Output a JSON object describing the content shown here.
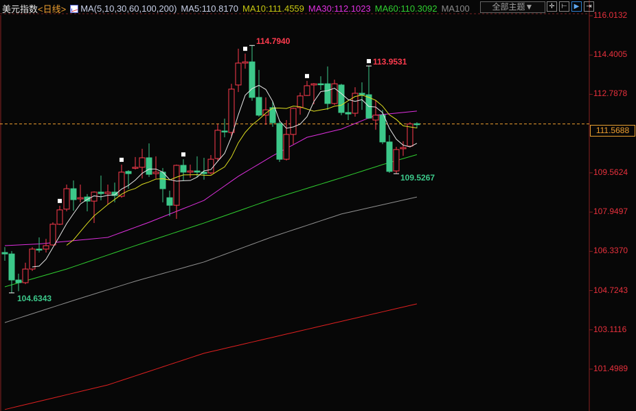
{
  "header": {
    "title": "美元指数",
    "period": "<日线>",
    "ma_label": "MA(5,10,30,60,100,200)",
    "ma5": "MA5:110.8170",
    "ma10": "MA10:111.4559",
    "ma30": "MA30:112.1023",
    "ma60": "MA60:110.3092",
    "ma100": "MA100",
    "theme_button": "全部主题▼",
    "tools": [
      "crosshair-tool",
      "range-tool",
      "move-right-tool",
      "move-end-tool"
    ]
  },
  "colors": {
    "up": "#ff3b4e",
    "down": "#3cc88a",
    "ma5": "#e8e8e8",
    "ma10": "#e0e020",
    "ma30": "#e030e0",
    "ma60": "#30d030",
    "ma100": "#909090",
    "ma200": "#e02020",
    "axis": "#e8303c",
    "last": "#f0a030"
  },
  "chart_data": {
    "type": "candlestick",
    "title": "美元指数 日线",
    "ylim": [
      99.78,
      116.66
    ],
    "yticks": [
      "116.0132",
      "114.4005",
      "112.7878",
      "109.5624",
      "107.9497",
      "106.3370",
      "104.7243",
      "103.1116",
      "101.4989"
    ],
    "last_price": "111.5688",
    "candles": [
      [
        106.29,
        106.23,
        106.51,
        105.95
      ],
      [
        106.23,
        105.16,
        106.35,
        104.63
      ],
      [
        105.16,
        105.05,
        105.42,
        104.7
      ],
      [
        105.05,
        105.61,
        105.87,
        104.99
      ],
      [
        105.61,
        106.43,
        106.51,
        105.53
      ],
      [
        106.43,
        106.4,
        106.91,
        106.29
      ],
      [
        106.43,
        106.57,
        106.85,
        106.29
      ],
      [
        106.6,
        107.45,
        107.53,
        106.57
      ],
      [
        107.45,
        108.04,
        108.21,
        107.42
      ],
      [
        108.07,
        108.91,
        109.08,
        107.98
      ],
      [
        108.91,
        108.46,
        109.25,
        108.01
      ],
      [
        108.49,
        108.54,
        109.08,
        108.35
      ],
      [
        108.57,
        108.4,
        108.69,
        107.98
      ],
      [
        108.4,
        108.77,
        108.8,
        107.5
      ],
      [
        108.77,
        108.71,
        109.45,
        108.43
      ],
      [
        108.71,
        108.77,
        109.08,
        108.26
      ],
      [
        108.77,
        108.63,
        109.16,
        108.35
      ],
      [
        108.6,
        109.59,
        109.9,
        108.54
      ],
      [
        109.62,
        109.53,
        109.67,
        108.91
      ],
      [
        109.76,
        109.79,
        110.21,
        109.7
      ],
      [
        109.79,
        110.18,
        110.55,
        109.33
      ],
      [
        110.18,
        109.5,
        110.77,
        109.39
      ],
      [
        109.53,
        109.59,
        110.24,
        109.33
      ],
      [
        109.59,
        108.91,
        109.76,
        108.35
      ],
      [
        108.54,
        108.23,
        108.83,
        107.78
      ],
      [
        108.23,
        109.87,
        109.9,
        107.67
      ],
      [
        109.87,
        109.59,
        110.12,
        109.25
      ],
      [
        109.59,
        109.64,
        109.9,
        109.36
      ],
      [
        109.64,
        109.59,
        110.24,
        109.39
      ],
      [
        109.59,
        109.53,
        110.18,
        109.28
      ],
      [
        109.56,
        110.12,
        110.29,
        109.5
      ],
      [
        110.15,
        111.31,
        111.56,
        110.07
      ],
      [
        111.28,
        111.25,
        111.79,
        111.02
      ],
      [
        111.22,
        113.0,
        113.22,
        111.02
      ],
      [
        113.17,
        114.07,
        114.66,
        112.88
      ],
      [
        114.07,
        114.12,
        114.46,
        113.84
      ],
      [
        114.12,
        112.66,
        114.794,
        112.52
      ],
      [
        112.66,
        111.93,
        113.79,
        111.87
      ],
      [
        111.93,
        112.15,
        112.66,
        111.53
      ],
      [
        112.24,
        111.62,
        112.49,
        111.45
      ],
      [
        111.59,
        110.12,
        111.73,
        110.01
      ],
      [
        110.12,
        111.14,
        111.73,
        110.07
      ],
      [
        111.14,
        112.21,
        112.24,
        110.74
      ],
      [
        112.24,
        112.72,
        112.86,
        111.95
      ],
      [
        112.74,
        113.14,
        113.34,
        112.72
      ],
      [
        113.17,
        113.22,
        113.25,
        112.38
      ],
      [
        113.22,
        113.2,
        113.53,
        112.97
      ],
      [
        113.22,
        112.41,
        113.93,
        112.15
      ],
      [
        112.41,
        113.22,
        113.39,
        112.35
      ],
      [
        113.17,
        112.04,
        113.22,
        111.93
      ],
      [
        112.04,
        111.98,
        112.43,
        111.73
      ],
      [
        112.01,
        112.83,
        113.08,
        111.87
      ],
      [
        112.83,
        112.77,
        113.28,
        112.15
      ],
      [
        112.77,
        111.81,
        113.953,
        111.78
      ],
      [
        111.73,
        111.93,
        112.55,
        111.33
      ],
      [
        111.93,
        110.83,
        112.15,
        110.74
      ],
      [
        110.83,
        109.62,
        111.11,
        109.56
      ],
      [
        109.64,
        110.52,
        110.63,
        109.527
      ],
      [
        110.55,
        110.6,
        110.86,
        110.26
      ],
      [
        110.66,
        111.57,
        111.64,
        110.66
      ],
      [
        111.58,
        111.57,
        111.64,
        111.39
      ]
    ],
    "markers": [
      8,
      17,
      26,
      35,
      44,
      53
    ],
    "extremes": [
      {
        "index": 36,
        "kind": "high",
        "label": "114.7940",
        "color": "#ff3b4e"
      },
      {
        "index": 53,
        "kind": "high",
        "label": "113.9531",
        "color": "#ff3b4e"
      },
      {
        "index": 1,
        "kind": "low",
        "label": "104.6343",
        "color": "#3cc88a"
      },
      {
        "index": 57,
        "kind": "low",
        "label": "109.5267",
        "color": "#3cc88a"
      }
    ],
    "ma_keyframes": {
      "ma30": [
        [
          0,
          106.57
        ],
        [
          5,
          106.64
        ],
        [
          15,
          106.91
        ],
        [
          21,
          107.53
        ],
        [
          29,
          108.43
        ],
        [
          34,
          109.42
        ],
        [
          39,
          110.26
        ],
        [
          44,
          111.02
        ],
        [
          49,
          111.36
        ],
        [
          54,
          111.93
        ],
        [
          60,
          112.1
        ]
      ],
      "ma60": [
        [
          0,
          104.88
        ],
        [
          9,
          105.61
        ],
        [
          19,
          106.57
        ],
        [
          29,
          107.5
        ],
        [
          39,
          108.49
        ],
        [
          49,
          109.36
        ],
        [
          55,
          109.9
        ],
        [
          60,
          110.31
        ]
      ],
      "ma100": [
        [
          0,
          103.41
        ],
        [
          10,
          104.32
        ],
        [
          19,
          105.11
        ],
        [
          29,
          105.9
        ],
        [
          39,
          106.94
        ],
        [
          49,
          107.87
        ],
        [
          60,
          108.57
        ]
      ],
      "ma200": [
        [
          0,
          99.84
        ],
        [
          15,
          100.85
        ],
        [
          29,
          102.15
        ],
        [
          45,
          103.2
        ],
        [
          60,
          104.18
        ]
      ]
    }
  }
}
